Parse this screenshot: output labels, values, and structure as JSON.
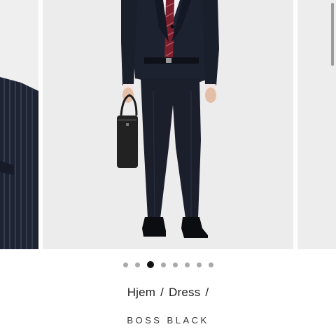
{
  "carousel": {
    "slide_count": 8,
    "active_index": 2,
    "colors": {
      "background": "#ececec",
      "suit": "#1d2230",
      "tie": "#7a1f2b",
      "bag": "#222222"
    }
  },
  "icons": {
    "zoom": "magnifier-icon"
  },
  "breadcrumb": {
    "items": [
      "Hjem",
      "Dress"
    ],
    "separator": "/"
  },
  "brand": {
    "name": "BOSS BLACK"
  }
}
